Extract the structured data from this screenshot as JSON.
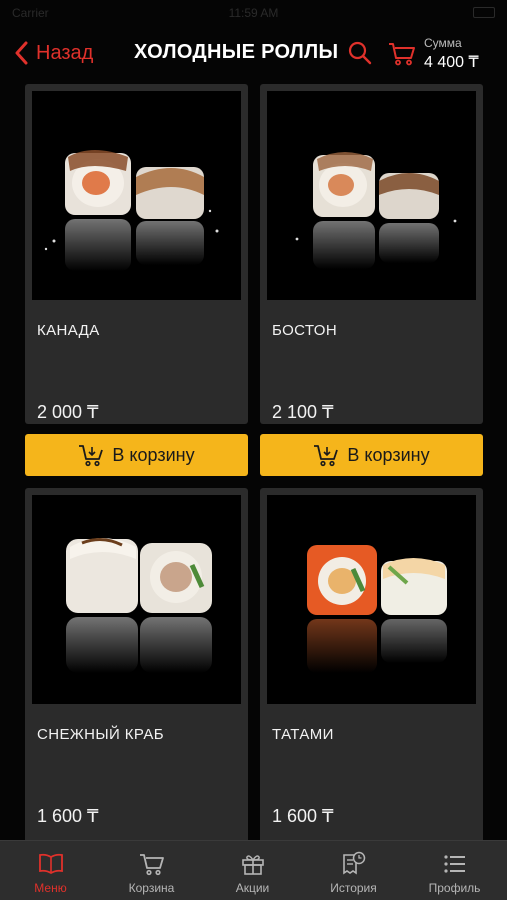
{
  "status_bar": {
    "carrier": "Carrier",
    "time": "11:59 AM"
  },
  "nav": {
    "back_label": "Назад",
    "title": "ХОЛОДНЫЕ РОЛЛЫ",
    "sum_label": "Сумма",
    "sum_value": "4 400 ₸"
  },
  "products": [
    {
      "name": "КАНАДА",
      "price": "2 000 ₸",
      "button": "В корзину"
    },
    {
      "name": "БОСТОН",
      "price": "2 100 ₸",
      "button": "В корзину"
    },
    {
      "name": "СНЕЖНЫЙ КРАБ",
      "price": "1 600 ₸"
    },
    {
      "name": "ТАТАМИ",
      "price": "1 600 ₸"
    }
  ],
  "tabs": [
    {
      "label": "Меню",
      "icon": "book-icon",
      "active": true
    },
    {
      "label": "Корзина",
      "icon": "cart-icon",
      "active": false
    },
    {
      "label": "Акции",
      "icon": "gift-icon",
      "active": false
    },
    {
      "label": "История",
      "icon": "receipt-clock-icon",
      "active": false
    },
    {
      "label": "Профиль",
      "icon": "list-icon",
      "active": false
    }
  ],
  "colors": {
    "accent": "#e0312b",
    "button": "#f5b51b",
    "card": "#2b2b2b",
    "tab_bar": "#2d2d2d"
  }
}
